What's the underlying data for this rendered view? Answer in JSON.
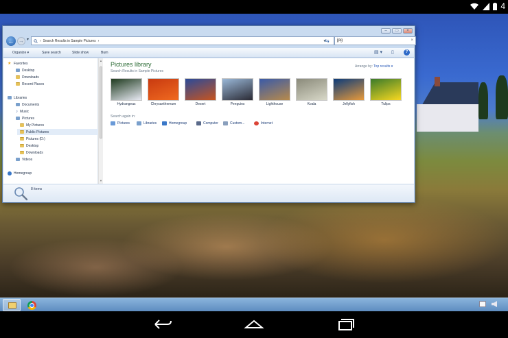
{
  "status_bar": {
    "battery_text": "4"
  },
  "window": {
    "address": {
      "path_text": "Search Results in Sample Pictures",
      "search_query": "jpg"
    },
    "toolbar": {
      "organize_label": "Organize",
      "save_search_label": "Save search",
      "slide_show_label": "Slide show",
      "burn_label": "Burn"
    },
    "nav_pane": {
      "favorites": {
        "header": "Favorites",
        "items": [
          "Desktop",
          "Downloads",
          "Recent Places"
        ]
      },
      "libraries": {
        "header": "Libraries",
        "documents": "Documents",
        "music": "Music",
        "pictures": "Pictures",
        "pictures_children": [
          "My Pictures",
          "Public Pictures",
          "Pictures (D:)",
          "Desktop",
          "Downloads"
        ],
        "videos": "Videos"
      },
      "homegroup": "Homegroup"
    },
    "main": {
      "title": "Pictures library",
      "subtitle": "Search Results in Sample Pictures",
      "arrange_label": "Arrange by:",
      "arrange_value": "Top results",
      "thumbnails": [
        {
          "label": "Hydrangeas",
          "colors": [
            "#1e3a1e",
            "#e8eaf4"
          ]
        },
        {
          "label": "Chrysanthemum",
          "colors": [
            "#c83a10",
            "#f06a20"
          ]
        },
        {
          "label": "Desert",
          "colors": [
            "#2a4a9a",
            "#c8541e"
          ]
        },
        {
          "label": "Penguins",
          "colors": [
            "#9ab8d8",
            "#2a2a34"
          ]
        },
        {
          "label": "Lighthouse",
          "colors": [
            "#3a5aa8",
            "#b88a4a"
          ]
        },
        {
          "label": "Koala",
          "colors": [
            "#8a8a7a",
            "#d8d8c8"
          ]
        },
        {
          "label": "Jellyfish",
          "colors": [
            "#0a3a7a",
            "#e89a3a"
          ]
        },
        {
          "label": "Tulips",
          "colors": [
            "#3a7a2a",
            "#f8d820"
          ]
        }
      ],
      "search_again_label": "Search again in:",
      "search_again_items": [
        "Pictures",
        "Libraries",
        "Homegroup",
        "Computer",
        "Custom...",
        "Internet"
      ]
    },
    "details": {
      "item_count": "8 items"
    }
  },
  "colors": {
    "accent_title": "#2a6a34",
    "link_blue": "#2a5ab8"
  }
}
